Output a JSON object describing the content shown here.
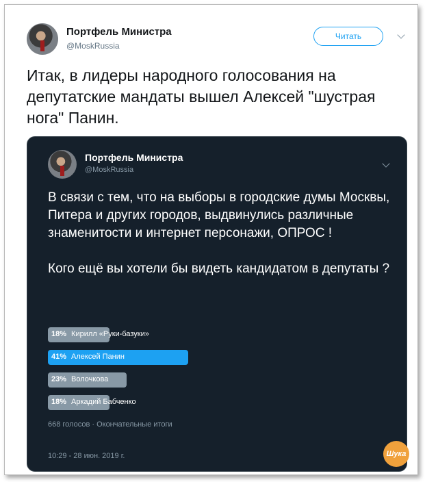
{
  "tweet": {
    "author_name": "Портфель Министра",
    "author_handle": "@MoskRussia",
    "follow_label": "Читать",
    "text": "Итак, в лидеры народного голосования на депутатские мандаты вышел Алексей \"шустрая нога\" Панин."
  },
  "quoted": {
    "author_name": "Портфель Министра",
    "author_handle": "@MoskRussia",
    "text": "В связи с тем, что на выборы в городские думы Москвы, Питера и других городов, выдвинулись различные знаменитости и интернет персонажи, ОПРОС !\n\nКого ещё вы хотели бы видеть кандидатом в депутаты ?",
    "poll": {
      "options": [
        {
          "percent_label": "18%",
          "label": "Кирилл «Руки-базуки»",
          "percent": 18,
          "winner": false
        },
        {
          "percent_label": "41%",
          "label": "Алексей Панин",
          "percent": 41,
          "winner": true
        },
        {
          "percent_label": "23%",
          "label": "Волочкова",
          "percent": 23,
          "winner": false
        },
        {
          "percent_label": "18%",
          "label": "Аркадий Бабченко",
          "percent": 18,
          "winner": false
        }
      ],
      "meta": "668 голосов · Окончательные итоги",
      "timestamp": "10:29 - 28 июн. 2019 г."
    }
  },
  "watermark": "Шука",
  "colors": {
    "accent": "#1da1f2",
    "card_bg": "#15202b",
    "bar_gray": "#8899a6"
  }
}
